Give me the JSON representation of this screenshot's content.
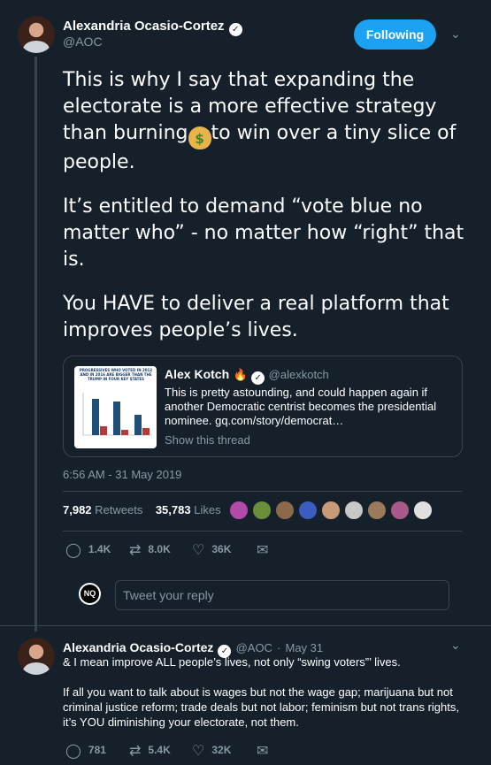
{
  "main_tweet": {
    "name": "Alexandria Ocasio-Cortez",
    "handle": "@AOC",
    "follow_label": "Following",
    "text_line1_before": "This is why I say that expanding the electorate is a more effective strategy than burning",
    "emoji": "money-bag",
    "text_line1_after": "to win over a tiny slice of people.",
    "text_para2": "It’s entitled to demand “vote blue no matter who” - no matter how “right” that is.",
    "text_para3": "You HAVE to deliver a real platform that improves people’s lives.",
    "timestamp": "6:56 AM - 31 May 2019",
    "retweets_count": "7,982",
    "retweets_label": "Retweets",
    "likes_count": "35,783",
    "likes_label": "Likes",
    "reply_count": "1.4K",
    "retweet_count": "8.0K",
    "like_count": "36K"
  },
  "quoted_tweet": {
    "name": "Alex Kotch",
    "handle": "@alexkotch",
    "text": "This is pretty astounding, and could happen again if another Democratic centrist becomes the presidential nominee. gq.com/story/democrat…",
    "show_thread": "Show this thread",
    "thumb_caption": "PROGRESSIVES WHO VOTED IN 2012 AND IN 2016 ARE BIGGER THAN THE TRUMP IN FOUR KEY STATES"
  },
  "reply_box": {
    "avatar_text": "NQ",
    "placeholder": "Tweet your reply"
  },
  "reply_tweet": {
    "name": "Alexandria Ocasio-Cortez",
    "handle": "@AOC",
    "date": "May 31",
    "line1": "& I mean improve ALL people’s lives, not only “swing voters”’ lives.",
    "line2": "If all you want to talk about is wages but not the wage gap; marijuana but not criminal justice reform; trade deals but not labor; feminism but not trans rights, it’s YOU diminishing your electorate, not them.",
    "reply_count": "781",
    "retweet_count": "5.4K",
    "like_count": "32K"
  },
  "colors": {
    "background": "#15202b",
    "accent": "#1da1f2",
    "muted": "#8899a6",
    "border": "#38444d"
  }
}
